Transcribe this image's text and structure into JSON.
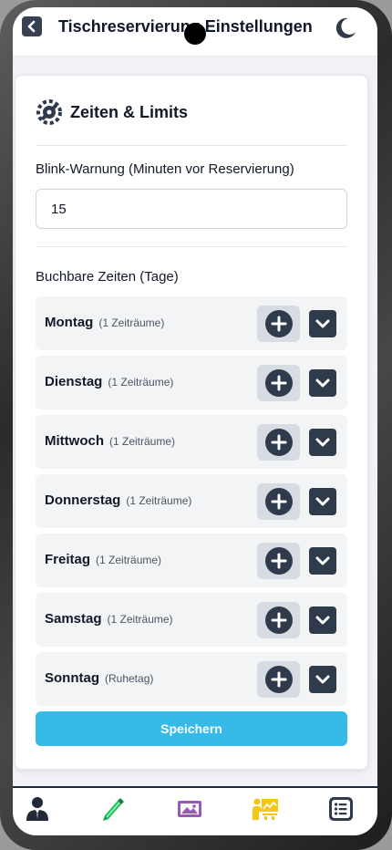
{
  "header": {
    "title": "Tischreservierung Einstellungen"
  },
  "section": {
    "title": "Zeiten & Limits"
  },
  "blink_warning": {
    "label": "Blink-Warnung (Minuten vor Reservierung)",
    "value": "15"
  },
  "bookable": {
    "label": "Buchbare Zeiten (Tage)",
    "days": [
      {
        "name": "Montag",
        "note": "(1 Zeiträume)"
      },
      {
        "name": "Dienstag",
        "note": "(1 Zeiträume)"
      },
      {
        "name": "Mittwoch",
        "note": "(1 Zeiträume)"
      },
      {
        "name": "Donnerstag",
        "note": "(1 Zeiträume)"
      },
      {
        "name": "Freitag",
        "note": "(1 Zeiträume)"
      },
      {
        "name": "Samstag",
        "note": "(1 Zeiträume)"
      },
      {
        "name": "Sonntag",
        "note": "(Ruhetag)"
      }
    ]
  },
  "save_label": "Speichern",
  "icons": {
    "back": "chevron-left-icon",
    "theme": "moon-icon",
    "section": "tools-icon",
    "add": "plus-circle-icon",
    "expand": "chevron-down-icon",
    "nav": [
      "user-tie-icon",
      "pen-icon",
      "image-icon",
      "presentation-icon",
      "list-icon"
    ]
  },
  "colors": {
    "accent": "#36bbe9",
    "dark": "#2f3a4a",
    "nav_green": "#22c55e",
    "nav_purple": "#9b59b6",
    "nav_yellow": "#f5c518"
  }
}
